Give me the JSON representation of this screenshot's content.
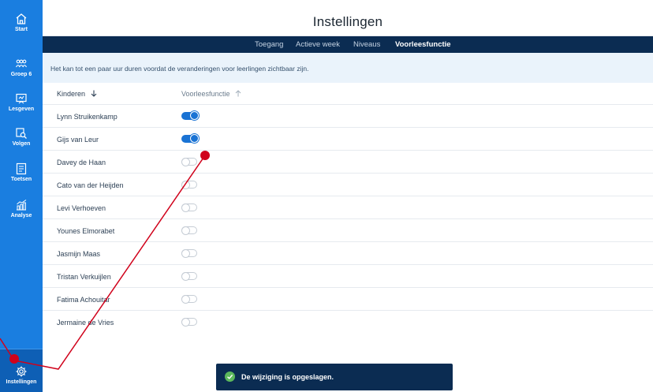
{
  "sidebar": {
    "items": [
      {
        "label": "Start",
        "icon": "home-icon"
      },
      {
        "label": "Groep 6",
        "icon": "group-icon"
      },
      {
        "label": "Lesgeven",
        "icon": "presentation-icon"
      },
      {
        "label": "Volgen",
        "icon": "follow-icon"
      },
      {
        "label": "Toetsen",
        "icon": "test-icon"
      },
      {
        "label": "Analyse",
        "icon": "chart-icon"
      },
      {
        "label": "Instellingen",
        "icon": "gear-icon"
      }
    ]
  },
  "header": {
    "title": "Instellingen"
  },
  "tabs": [
    {
      "label": "Toegang"
    },
    {
      "label": "Actieve week"
    },
    {
      "label": "Niveaus"
    },
    {
      "label": "Voorleesfunctie"
    }
  ],
  "notice": "Het kan tot een paar uur duren voordat de veranderingen voor leerlingen zichtbaar zijn.",
  "table": {
    "col_name": "Kinderen",
    "col_voor": "Voorleesfunctie",
    "rows": [
      {
        "name": "Lynn Struikenkamp",
        "on": true
      },
      {
        "name": "Gijs van Leur",
        "on": true
      },
      {
        "name": "Davey de Haan",
        "on": false
      },
      {
        "name": "Cato van der Heijden",
        "on": false
      },
      {
        "name": "Levi Verhoeven",
        "on": false
      },
      {
        "name": "Younes Elmorabet",
        "on": false
      },
      {
        "name": "Jasmijn Maas",
        "on": false
      },
      {
        "name": "Tristan Verkuijlen",
        "on": false
      },
      {
        "name": "Fatima Achouitar",
        "on": false
      },
      {
        "name": "Jermaine de Vries",
        "on": false
      }
    ]
  },
  "toast": {
    "message": "De wijziging is opgeslagen."
  },
  "colors": {
    "sidebar": "#1a7ee0",
    "tabbar": "#0b2c52",
    "toggle_on": "#1a73d4",
    "annotation": "#d0021b",
    "success": "#5cb85c"
  }
}
